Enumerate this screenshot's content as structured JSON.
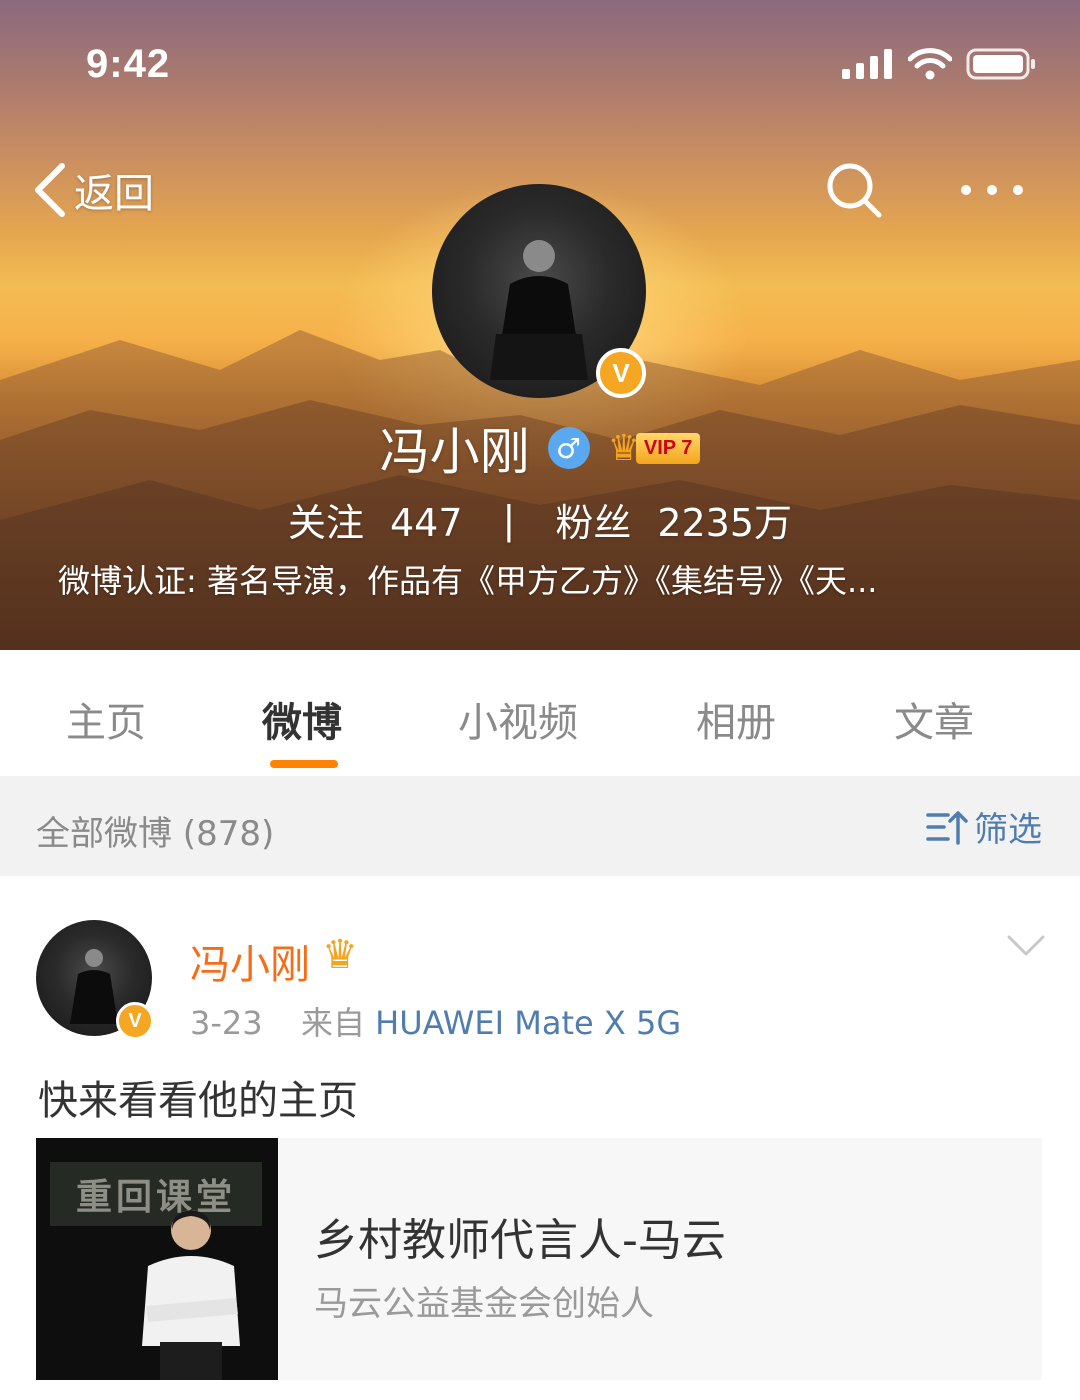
{
  "status_bar": {
    "time": "9:42"
  },
  "nav": {
    "back_label": "返回"
  },
  "profile": {
    "name": "冯小刚",
    "verified_badge": "V",
    "gender_symbol": "♂",
    "vip_label": "VIP 7",
    "following_label": "关注",
    "following_count": "447",
    "separator": "|",
    "followers_label": "粉丝",
    "followers_count": "2235万",
    "verification": "微博认证: 著名导演，作品有《甲方乙方》《集结号》《天..."
  },
  "tabs": [
    {
      "label": "主页",
      "active": false
    },
    {
      "label": "微博",
      "active": true
    },
    {
      "label": "小视频",
      "active": false
    },
    {
      "label": "相册",
      "active": false
    },
    {
      "label": "文章",
      "active": false
    }
  ],
  "filter": {
    "count_label": "全部微博 (878)",
    "button_label": "筛选"
  },
  "post": {
    "author": "冯小刚",
    "verified_badge": "V",
    "date": "3-23",
    "source_prefix": "来自",
    "device": "HUAWEI Mate X 5G",
    "text": "快来看看他的主页",
    "card": {
      "thumb_sign": "重回课堂",
      "title": "乡村教师代言人-马云",
      "subtitle": "马云公益基金会创始人"
    }
  },
  "colors": {
    "accent_orange": "#ff8200",
    "author_orange": "#f86c18",
    "link_blue": "#507daf",
    "verified_gold": "#f5a623",
    "gender_blue": "#5aa9f0"
  },
  "icons": [
    "back-chevron-icon",
    "search-icon",
    "more-icon",
    "signal-icon",
    "wifi-icon",
    "battery-icon",
    "crown-icon",
    "filter-icon",
    "chevron-down-icon"
  ]
}
